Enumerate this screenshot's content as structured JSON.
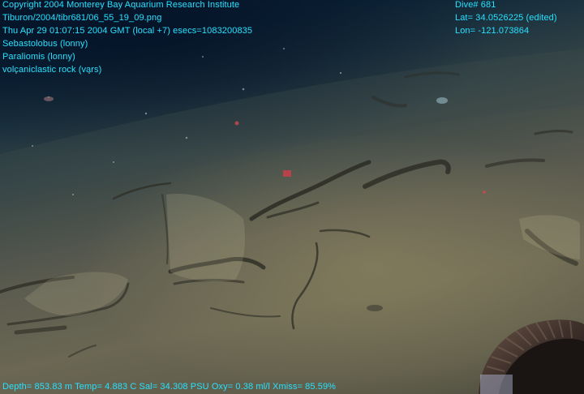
{
  "overlay": {
    "top_left": [
      "Copyright 2004 Monterey Bay Aquarium Research Institute",
      "Tiburon/2004/tibr681/06_55_19_09.png",
      "Thu Apr 29 01:07:15 2004 GMT (local +7)  esecs=1083200835",
      "Sebastolobus (lonny)",
      "Paraliomis (lonny)",
      "volcaniclastic rock (vars)"
    ],
    "top_right": [
      "Dive# 681",
      "Lat= 34.0526225 (edited)",
      "Lon= -121.073864"
    ],
    "bottom": "Depth= 853.83 m  Temp= 4.883 C  Sal= 34.308 PSU  Oxy= 0.38 ml/l  Xmiss= 85.59%"
  },
  "colors": {
    "overlay_text": "#27e1ff",
    "water_dark": "#06162a",
    "sediment": "#6a6753",
    "hose": "#4a3a34"
  },
  "scene_description_icons": [
    "seafloor-sediment",
    "volcaniclastic-rock",
    "sampling-hose"
  ]
}
